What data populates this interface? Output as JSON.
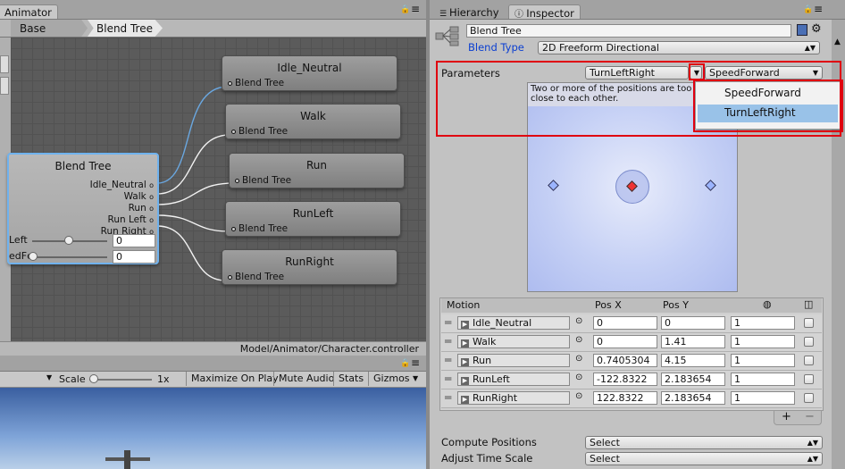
{
  "animator": {
    "tab": "Animator",
    "breadcrumb": [
      "Base Layer",
      "Blend Tree"
    ],
    "path": "Model/Animator/Character.controller",
    "nodes": [
      {
        "title": "Idle_Neutral",
        "port": "Blend Tree"
      },
      {
        "title": "Walk",
        "port": "Blend Tree"
      },
      {
        "title": "Run",
        "port": "Blend Tree"
      },
      {
        "title": "RunLeft",
        "port": "Blend Tree"
      },
      {
        "title": "RunRight",
        "port": "Blend Tree"
      }
    ],
    "blend_node": {
      "title": "Blend Tree",
      "outputs": [
        "Idle_Neutral",
        "Walk",
        "Run",
        "Run Left",
        "Run Right"
      ],
      "params": [
        {
          "label": "Left",
          "value": "0"
        },
        {
          "label": "edFc",
          "value": "0"
        }
      ]
    }
  },
  "game": {
    "scale_label": "Scale",
    "scale_value": "1x",
    "buttons": [
      "Maximize On Play",
      "Mute Audio",
      "Stats",
      "Gizmos"
    ]
  },
  "inspector": {
    "tabs": [
      "Hierarchy",
      "Inspector"
    ],
    "name": "Blend Tree",
    "blend_type_label": "Blend Type",
    "blend_type": "2D Freeform Directional",
    "parameters_label": "Parameters",
    "param_x": "TurnLeftRight",
    "param_y": "SpeedForward",
    "dropdown_options": [
      "SpeedForward",
      "TurnLeftRight"
    ],
    "dropdown_selected": "TurnLeftRight",
    "warning": "Two or more of the positions are too close to each other.",
    "motion_headers": [
      "Motion",
      "Pos X",
      "Pos Y"
    ],
    "motions": [
      {
        "name": "Idle_Neutral",
        "x": "0",
        "y": "0",
        "speed": "1"
      },
      {
        "name": "Walk",
        "x": "0",
        "y": "1.41",
        "speed": "1"
      },
      {
        "name": "Run",
        "x": "0.7405304",
        "y": "4.15",
        "speed": "1"
      },
      {
        "name": "RunLeft",
        "x": "-122.8322",
        "y": "2.183654",
        "speed": "1"
      },
      {
        "name": "RunRight",
        "x": "122.8322",
        "y": "2.183654",
        "speed": "1"
      }
    ],
    "add": "+",
    "remove": "−",
    "compute_label": "Compute Positions",
    "compute_value": "Select",
    "adjust_label": "Adjust Time Scale",
    "adjust_value": "Select"
  }
}
